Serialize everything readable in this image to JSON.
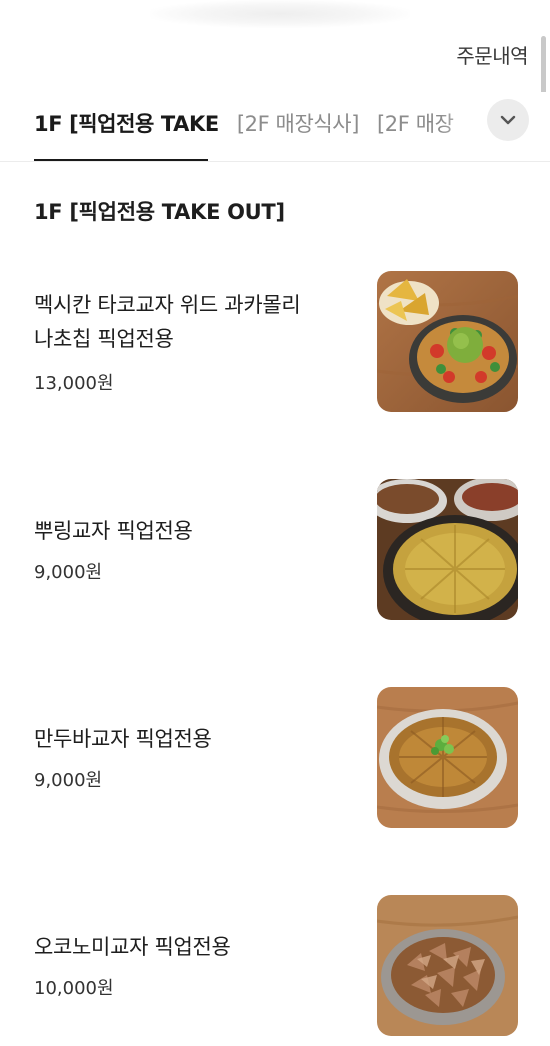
{
  "header": {
    "order_history_label": "주문내역"
  },
  "tabs": [
    {
      "label": "1F [픽업전용 TAKE",
      "active": true
    },
    {
      "label": "[2F 매장식사]",
      "active": false
    },
    {
      "label": "[2F 매장",
      "active": false
    }
  ],
  "expand_icon": "chevron-down-icon",
  "section": {
    "title": "1F [픽업전용 TAKE OUT]"
  },
  "menu": [
    {
      "name_line1": "멕시칸 타코교자 위드 과카몰리",
      "name_line2": "나초칩 픽업전용",
      "price": "13,000원",
      "image": "taco-gyoza-guacamole-nachos-photo"
    },
    {
      "name": "뿌링교자 픽업전용",
      "price": "9,000원",
      "image": "pburing-gyoza-photo"
    },
    {
      "name": "만두바교자 픽업전용",
      "price": "9,000원",
      "image": "mandu-bar-gyoza-photo"
    },
    {
      "name": "오코노미교자 픽업전용",
      "price": "10,000원",
      "image": "okonomi-gyoza-photo"
    }
  ],
  "colors": {
    "text_primary": "#1e1e1e",
    "tab_inactive": "#8c8c8c",
    "divider": "#ececec",
    "expand_button_bg": "#ececec"
  }
}
